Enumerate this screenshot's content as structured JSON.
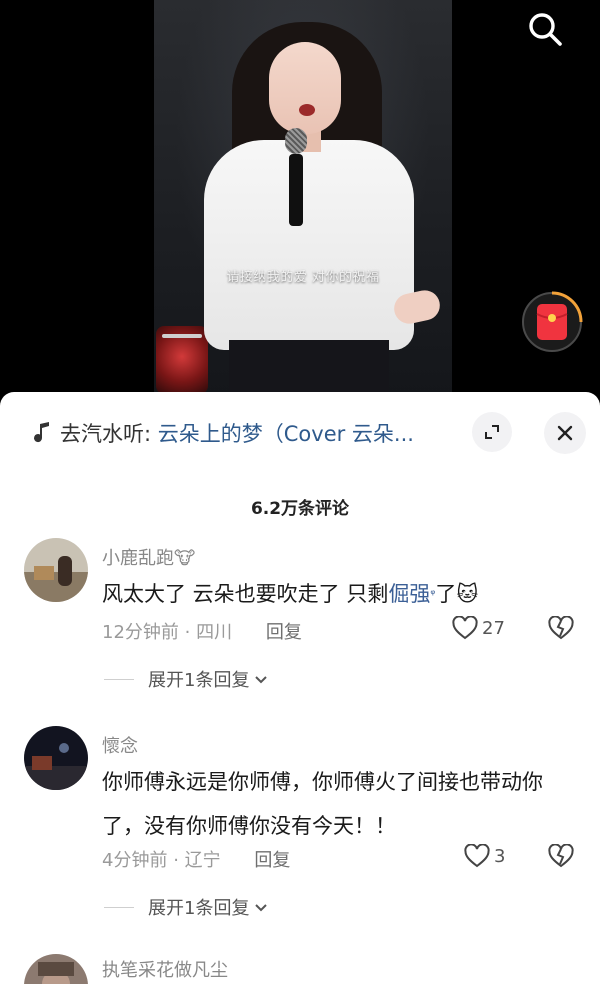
{
  "video": {
    "subtitle": "请接纳我的爱 对你的祝福",
    "search_icon": "search-icon",
    "red_packet_icon": "red-packet-icon"
  },
  "sheet": {
    "music": {
      "prefix": "去汽水听:",
      "title": "云朵上的梦（Cover 云朵..."
    },
    "comment_count": "6.2万条评论",
    "comments": [
      {
        "username": "小鹿乱跑🐮",
        "text_before": "风太大了 云朵也要吹走了 只剩",
        "text_link": "倔强",
        "text_after": "了",
        "emoji": "🐱",
        "time": "12分钟前",
        "location": "四川",
        "reply_label": "回复",
        "likes": "27",
        "expand_label": "展开1条回复"
      },
      {
        "username": "懷念",
        "text": "你师傅永远是你师傅，你师傅火了间接也带动你了，没有你师傅你没有今天！！",
        "time": "4分钟前",
        "location": "辽宁",
        "reply_label": "回复",
        "likes": "3",
        "expand_label": "展开1条回复"
      },
      {
        "username": "执笔采花做凡尘"
      }
    ]
  },
  "colors": {
    "link": "#3b5f96",
    "music_title": "#2f5a8c",
    "red_packet": "#f0343f",
    "ring": "#f2a23a"
  }
}
